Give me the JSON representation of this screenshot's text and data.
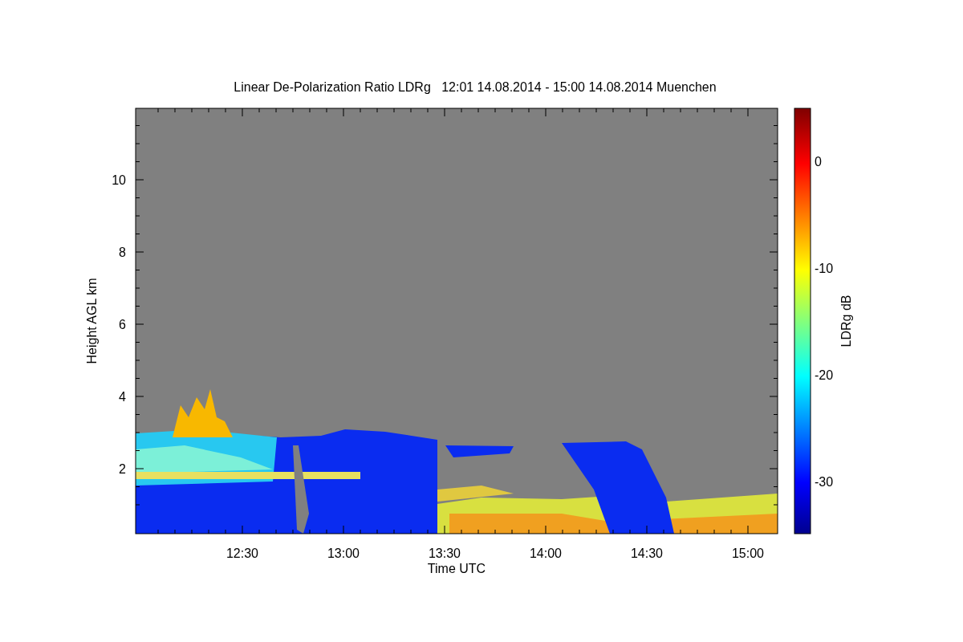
{
  "title": "Linear De-Polarization Ratio LDRg   12:01 14.08.2014 - 15:00 14.08.2014 Muenchen",
  "y_axis": {
    "label": "Height AGL km",
    "ticks": [
      "10",
      "8",
      "6",
      "4",
      "2"
    ]
  },
  "x_axis": {
    "label": "Time UTC",
    "ticks": [
      "12:30",
      "13:00",
      "13:30",
      "14:00",
      "14:30",
      "15:00"
    ]
  },
  "colorbar": {
    "label": "LDRg dB",
    "ticks": [
      "0",
      "-10",
      "-20",
      "-30"
    ]
  }
}
